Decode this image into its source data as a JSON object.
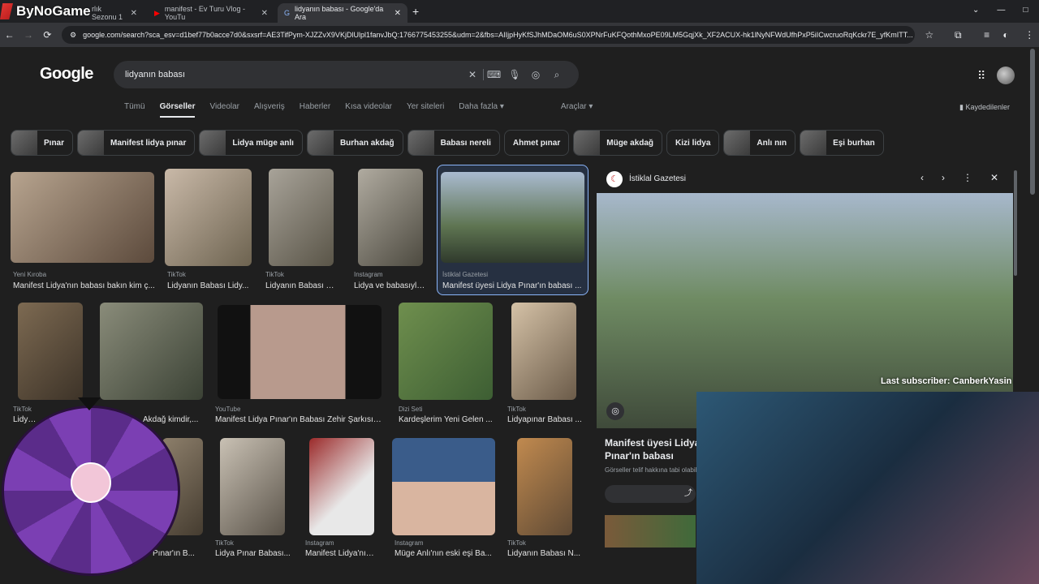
{
  "browser": {
    "tabs": [
      {
        "label": "rlık Sezonu 1",
        "active": false
      },
      {
        "label": "manifest - Ev Turu Vlog - YouTu",
        "active": false
      },
      {
        "label": "lidyanın babası - Google'da Ara",
        "active": true
      }
    ],
    "url": "google.com/search?sca_esv=d1bef77b0acce7d0&sxsrf=AE3TifPym-XJZZvX9VKjDlUlpl1fanvJbQ:1766775453255&udm=2&fbs=AIIjpHyKfSJhMDaOM6uS0XPNrFuKFQothMxoPE09LM5GqjXk_XF2ACUX-hk1lNyNFWdUfhPxP5iICwcruoRqKckr7E_yfKmITT..."
  },
  "overlay": {
    "logo_text": "ByNoGame",
    "last_subscriber": "Last subscriber: CanberkYasin"
  },
  "google": {
    "logo": "Google",
    "query": "lidyanın babası",
    "tabs": [
      "Tümü",
      "Görseller",
      "Videolar",
      "Alışveriş",
      "Haberler",
      "Kısa videolar",
      "Yer siteleri",
      "Daha fazla ▾"
    ],
    "active_tab": "Görseller",
    "tools": "Araçlar ▾",
    "saved": "Kaydedilenler",
    "chips": [
      "Pınar",
      "Manifest lidya pınar",
      "Lidya müge anlı",
      "Burhan akdağ",
      "Babası nereli",
      "Ahmet pınar",
      "Müge akdağ",
      "Kizi lidya",
      "Anlı nın",
      "Eşi burhan"
    ]
  },
  "results": [
    {
      "source": "Yeni Kıroba",
      "caption": "Manifest Lidya'nın babası bakın kim ç..."
    },
    {
      "source": "TikTok",
      "caption": "Lidyanın Babası Lidy..."
    },
    {
      "source": "TikTok",
      "caption": "Lidyanın Babası N..."
    },
    {
      "source": "Instagram",
      "caption": "Lidya ve babasıyla..."
    },
    {
      "source": "İstiklal Gazetesi",
      "caption": "Manifest üyesi Lidya Pınar'ın babası ..."
    },
    {
      "source": "TikTok",
      "caption": "Lidya..."
    },
    {
      "source": "",
      "caption": "Akdağ kimdir,..."
    },
    {
      "source": "YouTube",
      "caption": "Manifest Lidya Pınar'ın Babası Zehir Şarkısını..."
    },
    {
      "source": "Dizi Seti",
      "caption": "Kardeşlerim Yeni Gelen ..."
    },
    {
      "source": "TikTok",
      "caption": "Lidyapınar Babası ..."
    },
    {
      "source": "",
      "caption": "Pınar'ın B..."
    },
    {
      "source": "TikTok",
      "caption": "Lidya Pınar Babası..."
    },
    {
      "source": "Instagram",
      "caption": "Manifest Lidya'nın ..."
    },
    {
      "source": "Instagram",
      "caption": "Müge Anlı'nın eski eşi Ba..."
    },
    {
      "source": "TikTok",
      "caption": "Lidyanın Babası N..."
    }
  ],
  "panel": {
    "source": "İstiklal Gazetesi",
    "title": "Manifest üyesi Lidya Pınar'ın babası kimdir? ... oynadı?",
    "note": "Görseller telif hakkına tabi olabil"
  }
}
